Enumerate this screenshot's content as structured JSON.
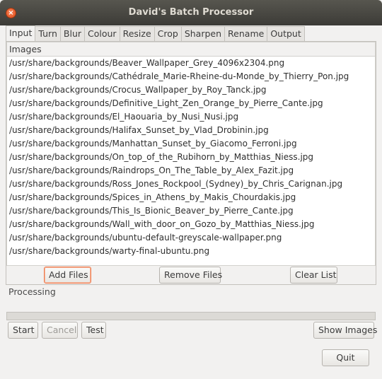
{
  "window": {
    "title": "David's Batch Processor",
    "close_glyph": "×"
  },
  "tabs": [
    {
      "label": "Input",
      "active": true
    },
    {
      "label": "Turn"
    },
    {
      "label": "Blur"
    },
    {
      "label": "Colour"
    },
    {
      "label": "Resize"
    },
    {
      "label": "Crop"
    },
    {
      "label": "Sharpen"
    },
    {
      "label": "Rename"
    },
    {
      "label": "Output"
    }
  ],
  "images": {
    "header": "Images",
    "files": [
      "/usr/share/backgrounds/Beaver_Wallpaper_Grey_4096x2304.png",
      "/usr/share/backgrounds/Cathédrale_Marie-Rheine-du-Monde_by_Thierry_Pon.jpg",
      "/usr/share/backgrounds/Crocus_Wallpaper_by_Roy_Tanck.jpg",
      "/usr/share/backgrounds/Definitive_Light_Zen_Orange_by_Pierre_Cante.jpg",
      "/usr/share/backgrounds/El_Haouaria_by_Nusi_Nusi.jpg",
      "/usr/share/backgrounds/Halifax_Sunset_by_Vlad_Drobinin.jpg",
      "/usr/share/backgrounds/Manhattan_Sunset_by_Giacomo_Ferroni.jpg",
      "/usr/share/backgrounds/On_top_of_the_Rubihorn_by_Matthias_Niess.jpg",
      "/usr/share/backgrounds/Raindrops_On_The_Table_by_Alex_Fazit.jpg",
      "/usr/share/backgrounds/Ross_Jones_Rockpool_(Sydney)_by_Chris_Carignan.jpg",
      "/usr/share/backgrounds/Spices_in_Athens_by_Makis_Chourdakis.jpg",
      "/usr/share/backgrounds/This_Is_Bionic_Beaver_by_Pierre_Cante.jpg",
      "/usr/share/backgrounds/Wall_with_door_on_Gozo_by_Matthias_Niess.jpg",
      "/usr/share/backgrounds/ubuntu-default-greyscale-wallpaper.png",
      "/usr/share/backgrounds/warty-final-ubuntu.png"
    ]
  },
  "buttons": {
    "add_files": "Add Files",
    "remove_files": "Remove Files",
    "clear_list": "Clear List",
    "start": "Start",
    "cancel": "Cancel",
    "test": "Test",
    "show_images": "Show Images",
    "quit": "Quit"
  },
  "processing": {
    "label": "Processing",
    "progress": 0
  },
  "colors": {
    "accent": "#e95420",
    "titlebar": "#3c3b37"
  }
}
